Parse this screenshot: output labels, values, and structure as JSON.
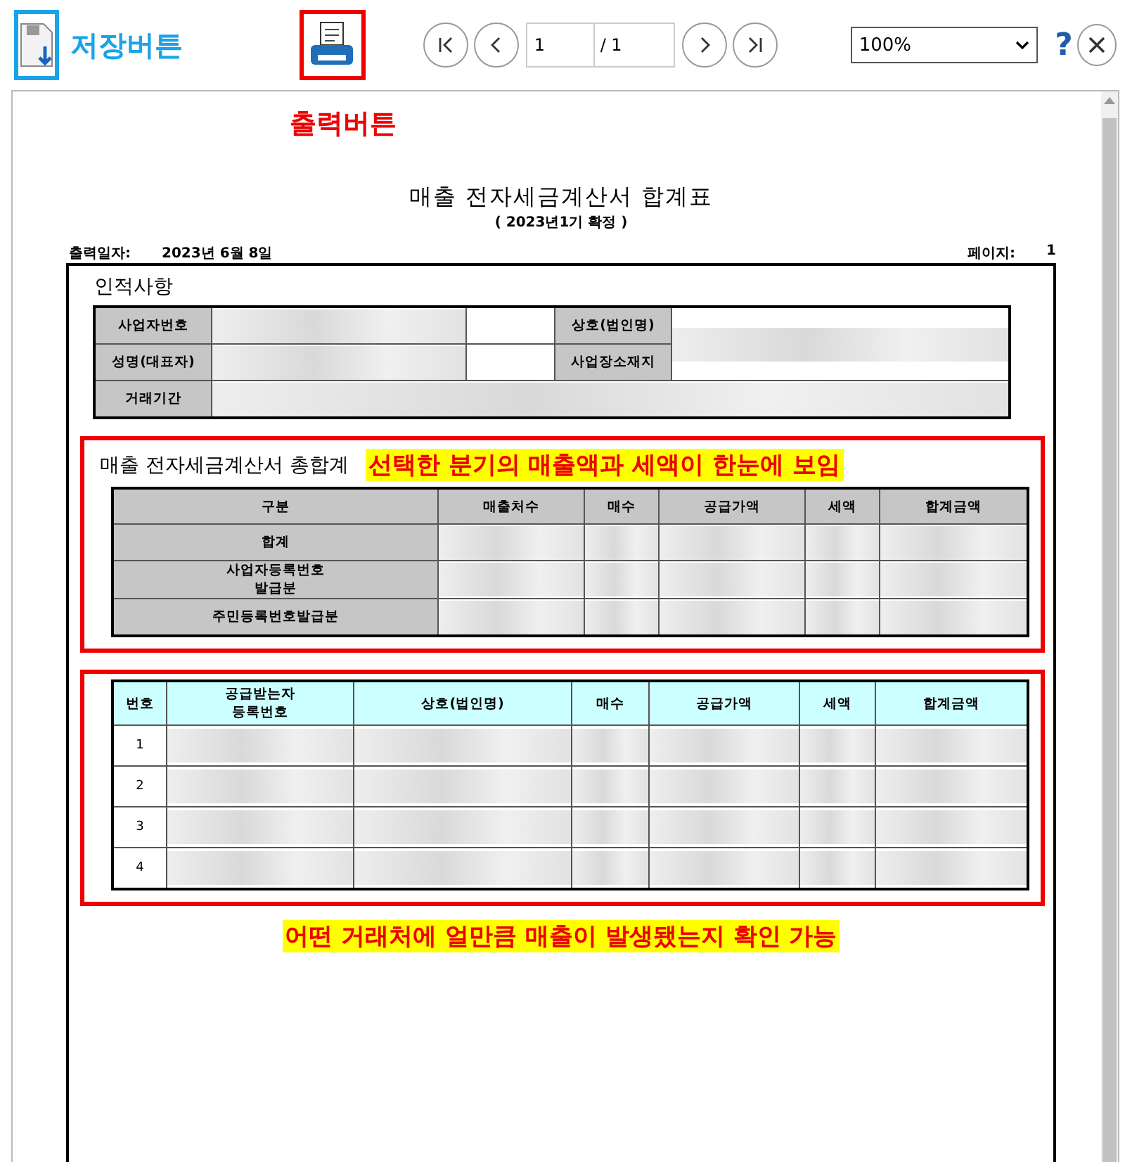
{
  "toolbar": {
    "save_label": "저장버튼",
    "print_label": "출력버튼",
    "page_input": "1",
    "page_total": "/ 1",
    "zoom": "100%",
    "help": "?"
  },
  "document": {
    "title": "매출 전자세금계산서 합계표",
    "subtitle": "( 2023년1기 확정 )",
    "print_date_label": "출력일자:",
    "print_date": "2023년 6월 8일",
    "page_label": "페이지:",
    "page_number": "1",
    "personal": {
      "heading": "인적사항",
      "fields": [
        "사업자번호",
        "성명(대표자)",
        "거래기간",
        "상호(법인명)",
        "사업장소재지"
      ]
    },
    "summary": {
      "heading": "매출 전자세금계산서 총합계",
      "note": "선택한 분기의 매출액과 세액이 한눈에 보임",
      "columns": [
        "구분",
        "매출처수",
        "매수",
        "공급가액",
        "세액",
        "합계금액"
      ],
      "rows": [
        "합계",
        "사업자등록번호\n발급분",
        "주민등록번호발급분"
      ]
    },
    "detail": {
      "columns": [
        "번호",
        "공급받는자\n등록번호",
        "상호(법인명)",
        "매수",
        "공급가액",
        "세액",
        "합계금액"
      ],
      "rows": [
        "1",
        "2",
        "3",
        "4"
      ],
      "note": "어떤 거래처에 얼만큼 매출이 발생됐는지 확인 가능"
    }
  }
}
